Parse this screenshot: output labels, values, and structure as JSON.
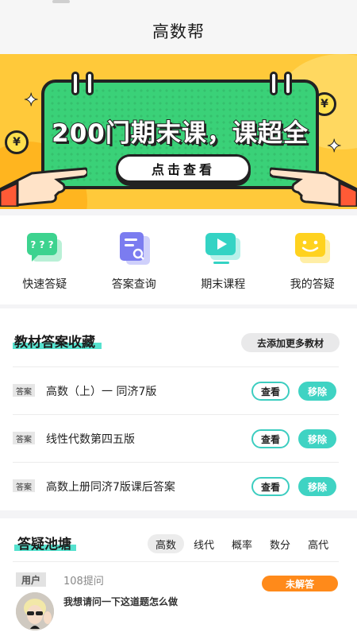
{
  "header": {
    "title": "高数帮"
  },
  "banner": {
    "headline": "200门期末课，课超全",
    "cta": "点击查看",
    "coin_symbol": "¥"
  },
  "quick_menu": [
    {
      "label": "快速答疑",
      "icon": "chat-question-icon",
      "color": "#3dd38f"
    },
    {
      "label": "答案查询",
      "icon": "document-search-icon",
      "color": "#7b7cf0"
    },
    {
      "label": "期末课程",
      "icon": "video-play-icon",
      "color": "#34d3c4"
    },
    {
      "label": "我的答疑",
      "icon": "smile-chat-icon",
      "color": "#ffd21f"
    }
  ],
  "textbooks": {
    "title": "教材答案收藏",
    "add_label": "去添加更多教材",
    "items": [
      {
        "tag": "答案",
        "title": "高数（上）一 同济7版",
        "view": "查看",
        "remove": "移除"
      },
      {
        "tag": "答案",
        "title": "线性代数第四五版",
        "view": "查看",
        "remove": "移除"
      },
      {
        "tag": "答案",
        "title": "高数上册同济7版课后答案",
        "view": "查看",
        "remove": "移除"
      }
    ]
  },
  "qa": {
    "title": "答疑池塘",
    "categories": [
      "高数",
      "线代",
      "概率",
      "数分",
      "高代"
    ],
    "active_category": "高数",
    "post": {
      "user_tag": "用户",
      "count": "108提问",
      "status": "未解答",
      "question": "我想请问一下这道题怎么做"
    }
  },
  "colors": {
    "accent": "#3fd3c3",
    "highlight": "#56e2cf",
    "banner": "#ffc93a",
    "card": "#3ad178",
    "warning": "#ff8a1a"
  }
}
